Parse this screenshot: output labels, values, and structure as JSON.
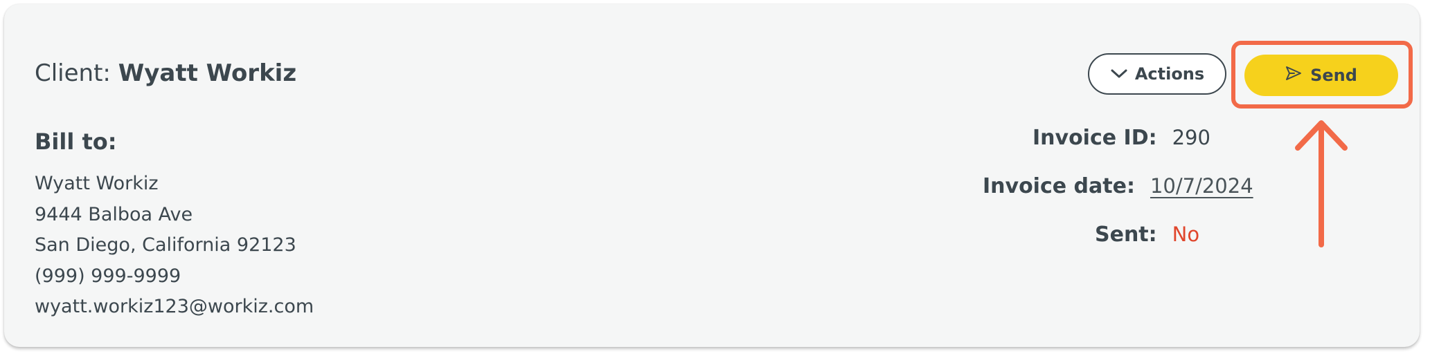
{
  "client": {
    "prefix": "Client:",
    "name": "Wyatt Workiz"
  },
  "bill_to": {
    "heading": "Bill to:",
    "lines": [
      "Wyatt Workiz",
      "9444 Balboa Ave",
      "San Diego, California 92123",
      "(999) 999-9999",
      "wyatt.workiz123@workiz.com"
    ]
  },
  "buttons": {
    "actions_label": "Actions",
    "send_label": "Send"
  },
  "invoice": {
    "id_label": "Invoice ID:",
    "id_value": "290",
    "date_label": "Invoice date:",
    "date_value": "10/7/2024",
    "sent_label": "Sent:",
    "sent_value": "No"
  },
  "icons": {
    "actions": "chevron-down-icon",
    "send": "paper-plane-icon",
    "annotation": "arrow-up-icon"
  },
  "colors": {
    "send_button": "#f6d11c",
    "highlight": "#f26a48",
    "sent_no": "#e0462c",
    "text": "#3c474e"
  }
}
